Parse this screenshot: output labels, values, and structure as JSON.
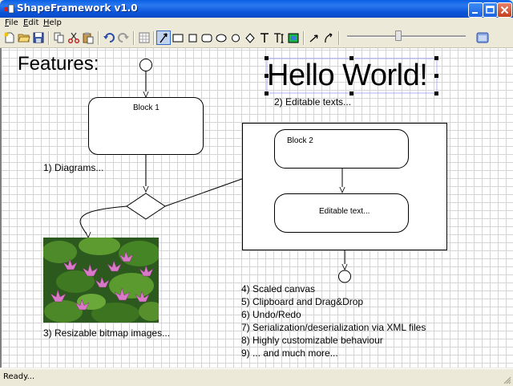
{
  "window": {
    "title": "ShapeFramework v1.0"
  },
  "menu": {
    "file": "File",
    "edit": "Edit",
    "help": "Help"
  },
  "toolbar": {
    "buttons": [
      "new-icon",
      "open-icon",
      "save-icon",
      "copy-icon",
      "cut-icon",
      "paste-icon",
      "undo-icon",
      "redo-icon",
      "grid-icon",
      "pointer-tool-icon",
      "rectangle-tool-icon",
      "square-tool-icon",
      "rounded-rect-tool-icon",
      "ellipse-tool-icon",
      "circle-tool-icon",
      "diamond-tool-icon",
      "text-tool-icon",
      "editable-text-tool-icon",
      "bitmap-tool-icon",
      "connection-tool-icon",
      "curve-connection-tool-icon",
      "window-icon"
    ],
    "selected_tool": "pointer-tool-icon",
    "zoom_slider_level": 0.42
  },
  "canvas": {
    "heading": "Features:",
    "hello_text": "Hello World!",
    "block1_label": "Block 1",
    "block2_label": "Block 2",
    "editable_label": "Editable text...",
    "feature1": "1) Diagrams...",
    "feature2": "2) Editable texts...",
    "feature3": "3) Resizable bitmap images...",
    "features": [
      "4) Scaled canvas",
      "5) Clipboard and Drag&Drop",
      "6) Undo/Redo",
      "7) Serialization/deserialization via XML files",
      "8) Highly customizable behaviour",
      "9) ... and much more..."
    ]
  },
  "status": {
    "text": "Ready..."
  },
  "colors": {
    "titlebar": "#0a5fe3",
    "grid": "#d4d4d4",
    "selection_handle": "#000000",
    "accent_selected": "#316ac5"
  }
}
